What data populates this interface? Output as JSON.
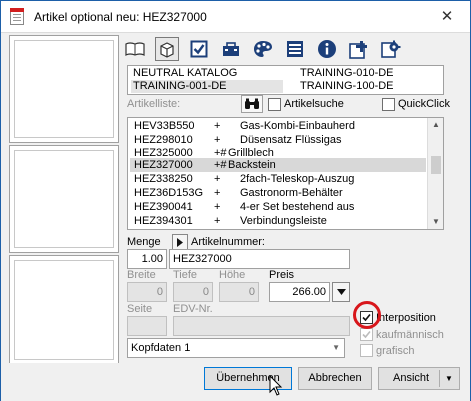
{
  "window": {
    "title": "Artikel optional neu: HEZ327000",
    "close_glyph": "✕"
  },
  "toolbar": {
    "icons": [
      "book-icon",
      "cube-icon",
      "checkbox-icon",
      "toolbox-icon",
      "palette-icon",
      "list-icon",
      "info-icon",
      "add-icon",
      "settings-icon"
    ],
    "selected": "cube-icon"
  },
  "catalog": {
    "left_top": "NEUTRAL KATALOG",
    "left_bottom": "TRAINING-001-DE",
    "right_top": "TRAINING-010-DE",
    "right_bottom": "TRAINING-100-DE"
  },
  "articles": {
    "label": "Artikelliste:",
    "search_label": "Artikelsuche",
    "quickclick_label": "QuickClick",
    "rows": [
      {
        "code": "HEV33B550",
        "flag": "+",
        "desc": "Gas-Kombi-Einbauherd"
      },
      {
        "code": "HEZ298010",
        "flag": "+",
        "desc": "Düsensatz Flüssigas"
      },
      {
        "code": "HEZ325000",
        "flag": "+#",
        "desc": "Grillblech"
      },
      {
        "code": "HEZ327000",
        "flag": "+#",
        "desc": "Backstein"
      },
      {
        "code": "HEZ338250",
        "flag": "+",
        "desc": "2fach-Teleskop-Auszug"
      },
      {
        "code": "HEZ36D153G",
        "flag": "+",
        "desc": "Gastronorm-Behälter"
      },
      {
        "code": "HEZ390041",
        "flag": "+",
        "desc": "4-er Set bestehend aus"
      },
      {
        "code": "HEZ394301",
        "flag": "+",
        "desc": "Verbindungsleiste"
      }
    ],
    "selected_index": 3
  },
  "fields": {
    "menge_label": "Menge",
    "menge_value": "1.00",
    "artikelnummer_label": "Artikelnummer:",
    "artikelnummer_value": "HEZ327000",
    "breite_label": "Breite",
    "breite_value": "0",
    "tiefe_label": "Tiefe",
    "tiefe_value": "0",
    "hoehe_label": "Höhe",
    "hoehe_value": "0",
    "preis_label": "Preis",
    "preis_value": "266.00",
    "seite_label": "Seite",
    "edv_label": "EDV-Nr."
  },
  "options": {
    "interposition_label": "Interposition",
    "interposition_checked": true,
    "kaufmaennisch_label": "kaufmännisch",
    "grafisch_label": "grafisch"
  },
  "combo": {
    "value": "Kopfdaten 1"
  },
  "buttons": {
    "ok": "Übernehmen",
    "cancel": "Abbrechen",
    "view": "Ansicht"
  },
  "colors": {
    "highlight_ring": "#d8161b",
    "title_border": "#1d5fa8"
  }
}
